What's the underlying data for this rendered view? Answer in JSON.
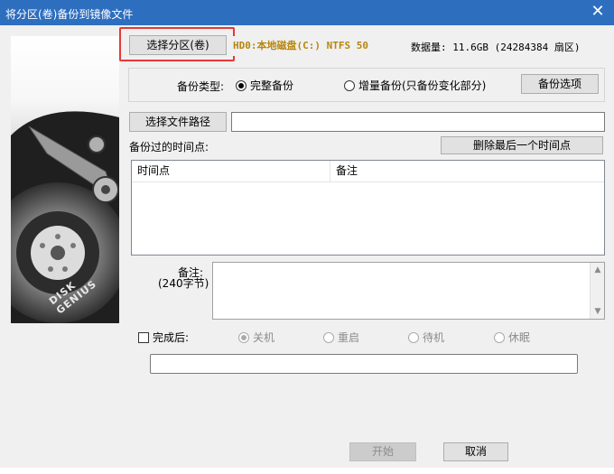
{
  "window": {
    "title": "将分区(卷)备份到镜像文件",
    "close_glyph": "✕"
  },
  "partition": {
    "select_button": "选择分区(卷)",
    "current": "HD0:本地磁盘(C:) NTFS 50",
    "data_size": "数据量: 11.6GB (24284384 扇区)"
  },
  "backup_type": {
    "label": "备份类型:",
    "full": "完整备份",
    "incremental": "增量备份(只备份变化部分)",
    "selected": "full",
    "options_button": "备份选项"
  },
  "file": {
    "select_path_button": "选择文件路径",
    "path_value": ""
  },
  "timepoints": {
    "label": "备份过的时间点:",
    "delete_last_button": "删除最后一个时间点",
    "columns": [
      "时间点",
      "备注"
    ],
    "rows": []
  },
  "notes": {
    "label": "备注:",
    "limit": "(240字节)",
    "value": ""
  },
  "after_complete": {
    "checkbox_label": "完成后:",
    "checked": false,
    "options": [
      "关机",
      "重启",
      "待机",
      "休眠"
    ],
    "selected_index": 0
  },
  "progress": {
    "value": 0
  },
  "actions": {
    "start": "开始",
    "cancel": "取消"
  },
  "side_art": {
    "brand": "DISK GENIUS"
  },
  "colors": {
    "titlebar": "#2d6ebf",
    "highlight": "#e53935",
    "partition_text": "#b8860b"
  }
}
